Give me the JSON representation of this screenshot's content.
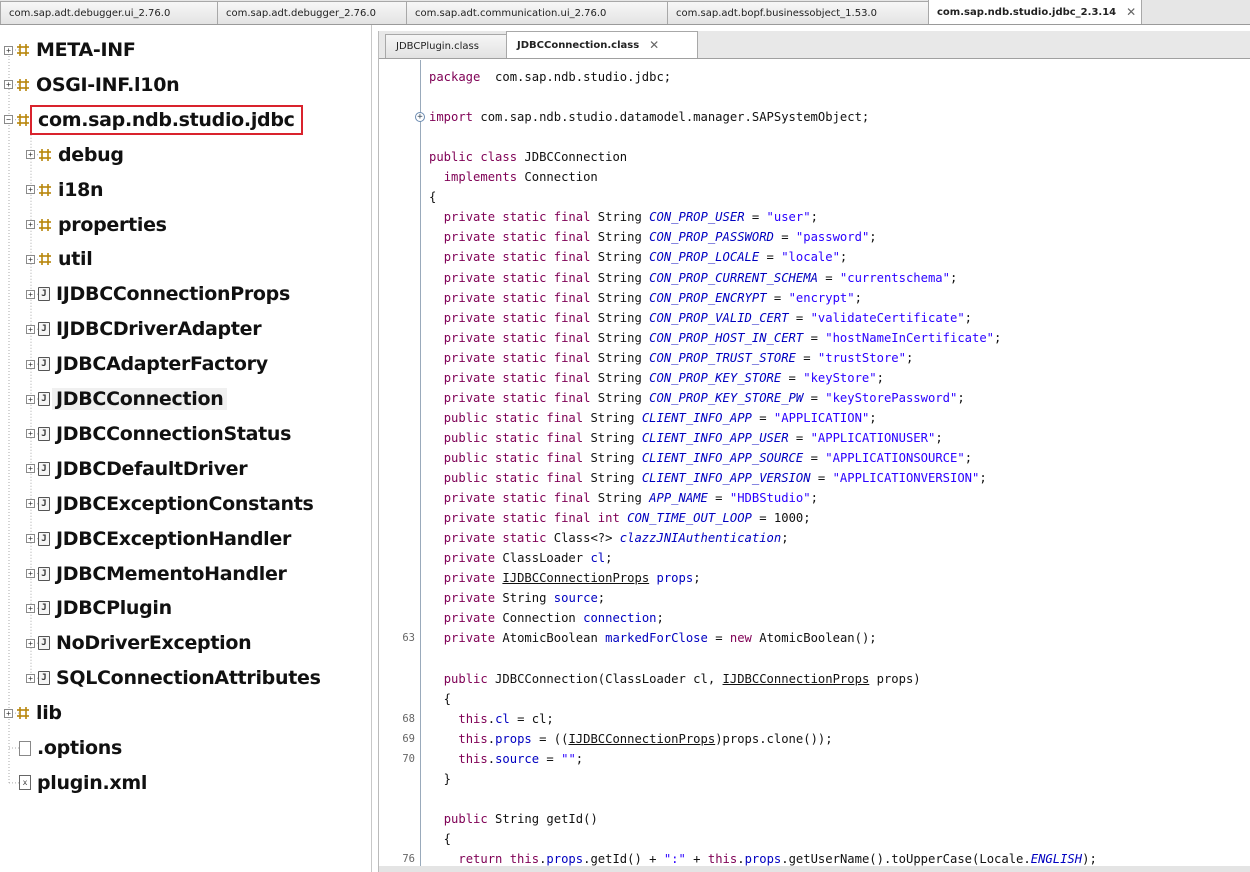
{
  "top_tabs": [
    {
      "label": "com.sap.adt.debugger.ui_2.76.0",
      "active": false
    },
    {
      "label": "com.sap.adt.debugger_2.76.0",
      "active": false
    },
    {
      "label": "com.sap.adt.communication.ui_2.76.0",
      "active": false
    },
    {
      "label": "com.sap.adt.bopf.businessobject_1.53.0",
      "active": false
    },
    {
      "label": "com.sap.ndb.studio.jdbc_2.3.14",
      "active": true
    }
  ],
  "tree": {
    "items": [
      {
        "label": "META-INF",
        "kind": "package",
        "level": 0
      },
      {
        "label": "OSGI-INF.l10n",
        "kind": "package",
        "level": 0
      },
      {
        "label": "com.sap.ndb.studio.jdbc",
        "kind": "package",
        "level": 0,
        "expanded": true,
        "highlighted": true
      },
      {
        "label": "debug",
        "kind": "package",
        "level": 1
      },
      {
        "label": "i18n",
        "kind": "package",
        "level": 1
      },
      {
        "label": "properties",
        "kind": "package",
        "level": 1
      },
      {
        "label": "util",
        "kind": "package",
        "level": 1
      },
      {
        "label": "IJDBCConnectionProps",
        "kind": "class",
        "level": 1
      },
      {
        "label": "IJDBCDriverAdapter",
        "kind": "class",
        "level": 1
      },
      {
        "label": "JDBCAdapterFactory",
        "kind": "class",
        "level": 1
      },
      {
        "label": "JDBCConnection",
        "kind": "class",
        "level": 1,
        "selected": true
      },
      {
        "label": "JDBCConnectionStatus",
        "kind": "class",
        "level": 1
      },
      {
        "label": "JDBCDefaultDriver",
        "kind": "class",
        "level": 1
      },
      {
        "label": "JDBCExceptionConstants",
        "kind": "class",
        "level": 1
      },
      {
        "label": "JDBCExceptionHandler",
        "kind": "class",
        "level": 1
      },
      {
        "label": "JDBCMementoHandler",
        "kind": "class",
        "level": 1
      },
      {
        "label": "JDBCPlugin",
        "kind": "class",
        "level": 1
      },
      {
        "label": "NoDriverException",
        "kind": "class",
        "level": 1
      },
      {
        "label": "SQLConnectionAttributes",
        "kind": "class",
        "level": 1
      },
      {
        "label": "lib",
        "kind": "package",
        "level": 0
      },
      {
        "label": ".options",
        "kind": "file",
        "level": 0
      },
      {
        "label": "plugin.xml",
        "kind": "xml",
        "level": 0
      }
    ]
  },
  "editor": {
    "tabs": [
      {
        "label": "JDBCPlugin.class",
        "active": false
      },
      {
        "label": "JDBCConnection.class",
        "active": true
      }
    ],
    "lines": [
      {
        "ln": "",
        "parts": [
          [
            "kw",
            "package"
          ],
          [
            "",
            "  com.sap.ndb.studio.jdbc;"
          ]
        ]
      },
      {
        "ln": "",
        "parts": []
      },
      {
        "ln": "",
        "fold": true,
        "parts": [
          [
            "kw",
            "import"
          ],
          [
            "",
            " com.sap.ndb.studio.datamodel.manager.SAPSystemObject;"
          ]
        ]
      },
      {
        "ln": "",
        "parts": []
      },
      {
        "ln": "",
        "parts": [
          [
            "kw",
            "public class"
          ],
          [
            "",
            " JDBCConnection"
          ]
        ]
      },
      {
        "ln": "",
        "parts": [
          [
            "",
            "  "
          ],
          [
            "kw",
            "implements"
          ],
          [
            "",
            " Connection"
          ]
        ]
      },
      {
        "ln": "",
        "parts": [
          [
            "",
            "{"
          ]
        ]
      },
      {
        "ln": "",
        "parts": [
          [
            "",
            "  "
          ],
          [
            "kw",
            "private static final"
          ],
          [
            "",
            " String "
          ],
          [
            "fld",
            "CON_PROP_USER"
          ],
          [
            "",
            " = "
          ],
          [
            "str",
            "\"user\""
          ],
          [
            "",
            ";"
          ]
        ]
      },
      {
        "ln": "",
        "parts": [
          [
            "",
            "  "
          ],
          [
            "kw",
            "private static final"
          ],
          [
            "",
            " String "
          ],
          [
            "fld",
            "CON_PROP_PASSWORD"
          ],
          [
            "",
            " = "
          ],
          [
            "str",
            "\"password\""
          ],
          [
            "",
            ";"
          ]
        ]
      },
      {
        "ln": "",
        "parts": [
          [
            "",
            "  "
          ],
          [
            "kw",
            "private static final"
          ],
          [
            "",
            " String "
          ],
          [
            "fld",
            "CON_PROP_LOCALE"
          ],
          [
            "",
            " = "
          ],
          [
            "str",
            "\"locale\""
          ],
          [
            "",
            ";"
          ]
        ]
      },
      {
        "ln": "",
        "parts": [
          [
            "",
            "  "
          ],
          [
            "kw",
            "private static final"
          ],
          [
            "",
            " String "
          ],
          [
            "fld",
            "CON_PROP_CURRENT_SCHEMA"
          ],
          [
            "",
            " = "
          ],
          [
            "str",
            "\"currentschema\""
          ],
          [
            "",
            ";"
          ]
        ]
      },
      {
        "ln": "",
        "parts": [
          [
            "",
            "  "
          ],
          [
            "kw",
            "private static final"
          ],
          [
            "",
            " String "
          ],
          [
            "fld",
            "CON_PROP_ENCRYPT"
          ],
          [
            "",
            " = "
          ],
          [
            "str",
            "\"encrypt\""
          ],
          [
            "",
            ";"
          ]
        ]
      },
      {
        "ln": "",
        "parts": [
          [
            "",
            "  "
          ],
          [
            "kw",
            "private static final"
          ],
          [
            "",
            " String "
          ],
          [
            "fld",
            "CON_PROP_VALID_CERT"
          ],
          [
            "",
            " = "
          ],
          [
            "str",
            "\"validateCertificate\""
          ],
          [
            "",
            ";"
          ]
        ]
      },
      {
        "ln": "",
        "parts": [
          [
            "",
            "  "
          ],
          [
            "kw",
            "private static final"
          ],
          [
            "",
            " String "
          ],
          [
            "fld",
            "CON_PROP_HOST_IN_CERT"
          ],
          [
            "",
            " = "
          ],
          [
            "str",
            "\"hostNameInCertificate\""
          ],
          [
            "",
            ";"
          ]
        ]
      },
      {
        "ln": "",
        "parts": [
          [
            "",
            "  "
          ],
          [
            "kw",
            "private static final"
          ],
          [
            "",
            " String "
          ],
          [
            "fld",
            "CON_PROP_TRUST_STORE"
          ],
          [
            "",
            " = "
          ],
          [
            "str",
            "\"trustStore\""
          ],
          [
            "",
            ";"
          ]
        ]
      },
      {
        "ln": "",
        "parts": [
          [
            "",
            "  "
          ],
          [
            "kw",
            "private static final"
          ],
          [
            "",
            " String "
          ],
          [
            "fld",
            "CON_PROP_KEY_STORE"
          ],
          [
            "",
            " = "
          ],
          [
            "str",
            "\"keyStore\""
          ],
          [
            "",
            ";"
          ]
        ]
      },
      {
        "ln": "",
        "parts": [
          [
            "",
            "  "
          ],
          [
            "kw",
            "private static final"
          ],
          [
            "",
            " String "
          ],
          [
            "fld",
            "CON_PROP_KEY_STORE_PW"
          ],
          [
            "",
            " = "
          ],
          [
            "str",
            "\"keyStorePassword\""
          ],
          [
            "",
            ";"
          ]
        ]
      },
      {
        "ln": "",
        "parts": [
          [
            "",
            "  "
          ],
          [
            "kw",
            "public static final"
          ],
          [
            "",
            " String "
          ],
          [
            "fld",
            "CLIENT_INFO_APP"
          ],
          [
            "",
            " = "
          ],
          [
            "str",
            "\"APPLICATION\""
          ],
          [
            "",
            ";"
          ]
        ]
      },
      {
        "ln": "",
        "parts": [
          [
            "",
            "  "
          ],
          [
            "kw",
            "public static final"
          ],
          [
            "",
            " String "
          ],
          [
            "fld",
            "CLIENT_INFO_APP_USER"
          ],
          [
            "",
            " = "
          ],
          [
            "str",
            "\"APPLICATIONUSER\""
          ],
          [
            "",
            ";"
          ]
        ]
      },
      {
        "ln": "",
        "parts": [
          [
            "",
            "  "
          ],
          [
            "kw",
            "public static final"
          ],
          [
            "",
            " String "
          ],
          [
            "fld",
            "CLIENT_INFO_APP_SOURCE"
          ],
          [
            "",
            " = "
          ],
          [
            "str",
            "\"APPLICATIONSOURCE\""
          ],
          [
            "",
            ";"
          ]
        ]
      },
      {
        "ln": "",
        "parts": [
          [
            "",
            "  "
          ],
          [
            "kw",
            "public static final"
          ],
          [
            "",
            " String "
          ],
          [
            "fld",
            "CLIENT_INFO_APP_VERSION"
          ],
          [
            "",
            " = "
          ],
          [
            "str",
            "\"APPLICATIONVERSION\""
          ],
          [
            "",
            ";"
          ]
        ]
      },
      {
        "ln": "",
        "parts": [
          [
            "",
            "  "
          ],
          [
            "kw",
            "private static final"
          ],
          [
            "",
            " String "
          ],
          [
            "fld",
            "APP_NAME"
          ],
          [
            "",
            " = "
          ],
          [
            "str",
            "\"HDBStudio\""
          ],
          [
            "",
            ";"
          ]
        ]
      },
      {
        "ln": "",
        "parts": [
          [
            "",
            "  "
          ],
          [
            "kw",
            "private static final int"
          ],
          [
            "",
            " "
          ],
          [
            "fld",
            "CON_TIME_OUT_LOOP"
          ],
          [
            "",
            " = 1000;"
          ]
        ]
      },
      {
        "ln": "",
        "parts": [
          [
            "",
            "  "
          ],
          [
            "kw",
            "private static"
          ],
          [
            "",
            " Class<?> "
          ],
          [
            "fld",
            "clazzJNIAuthentication"
          ],
          [
            "",
            ";"
          ]
        ]
      },
      {
        "ln": "",
        "parts": [
          [
            "",
            "  "
          ],
          [
            "kw",
            "private"
          ],
          [
            "",
            " ClassLoader "
          ],
          [
            "fldn",
            "cl"
          ],
          [
            "",
            ";"
          ]
        ]
      },
      {
        "ln": "",
        "parts": [
          [
            "",
            "  "
          ],
          [
            "kw",
            "private"
          ],
          [
            "",
            " "
          ],
          [
            "ul",
            "IJDBCConnectionProps"
          ],
          [
            "",
            " "
          ],
          [
            "fldn",
            "props"
          ],
          [
            "",
            ";"
          ]
        ]
      },
      {
        "ln": "",
        "parts": [
          [
            "",
            "  "
          ],
          [
            "kw",
            "private"
          ],
          [
            "",
            " String "
          ],
          [
            "fldn",
            "source"
          ],
          [
            "",
            ";"
          ]
        ]
      },
      {
        "ln": "",
        "parts": [
          [
            "",
            "  "
          ],
          [
            "kw",
            "private"
          ],
          [
            "",
            " Connection "
          ],
          [
            "fldn",
            "connection"
          ],
          [
            "",
            ";"
          ]
        ]
      },
      {
        "ln": "63",
        "parts": [
          [
            "",
            "  "
          ],
          [
            "kw",
            "private"
          ],
          [
            "",
            " AtomicBoolean "
          ],
          [
            "fldn",
            "markedForClose"
          ],
          [
            "",
            " = "
          ],
          [
            "kw",
            "new"
          ],
          [
            "",
            " AtomicBoolean();"
          ]
        ]
      },
      {
        "ln": "",
        "parts": []
      },
      {
        "ln": "",
        "parts": [
          [
            "",
            "  "
          ],
          [
            "kw",
            "public"
          ],
          [
            "",
            " JDBCConnection(ClassLoader cl, "
          ],
          [
            "ul",
            "IJDBCConnectionProps"
          ],
          [
            "",
            " props)"
          ]
        ]
      },
      {
        "ln": "",
        "parts": [
          [
            "",
            "  {"
          ]
        ]
      },
      {
        "ln": "68",
        "parts": [
          [
            "",
            "    "
          ],
          [
            "kw",
            "this"
          ],
          [
            "",
            "."
          ],
          [
            "fldn",
            "cl"
          ],
          [
            "",
            " = cl;"
          ]
        ]
      },
      {
        "ln": "69",
        "parts": [
          [
            "",
            "    "
          ],
          [
            "kw",
            "this"
          ],
          [
            "",
            "."
          ],
          [
            "fldn",
            "props"
          ],
          [
            "",
            " = (("
          ],
          [
            "ul",
            "IJDBCConnectionProps"
          ],
          [
            "",
            ")props.clone());"
          ]
        ]
      },
      {
        "ln": "70",
        "parts": [
          [
            "",
            "    "
          ],
          [
            "kw",
            "this"
          ],
          [
            "",
            "."
          ],
          [
            "fldn",
            "source"
          ],
          [
            "",
            " = "
          ],
          [
            "str",
            "\"\""
          ],
          [
            "",
            ";"
          ]
        ]
      },
      {
        "ln": "",
        "parts": [
          [
            "",
            "  }"
          ]
        ]
      },
      {
        "ln": "",
        "parts": []
      },
      {
        "ln": "",
        "parts": [
          [
            "",
            "  "
          ],
          [
            "kw",
            "public"
          ],
          [
            "",
            " String getId()"
          ]
        ]
      },
      {
        "ln": "",
        "parts": [
          [
            "",
            "  {"
          ]
        ]
      },
      {
        "ln": "76",
        "parts": [
          [
            "",
            "    "
          ],
          [
            "kw",
            "return this"
          ],
          [
            "",
            "."
          ],
          [
            "fldn",
            "props"
          ],
          [
            "",
            ".getId() + "
          ],
          [
            "str",
            "\":\""
          ],
          [
            "",
            " + "
          ],
          [
            "kw",
            "this"
          ],
          [
            "",
            "."
          ],
          [
            "fldn",
            "props"
          ],
          [
            "",
            ".getUserName().toUpperCase(Locale."
          ],
          [
            "fld",
            "ENGLISH"
          ],
          [
            "",
            ");"
          ]
        ]
      }
    ]
  }
}
